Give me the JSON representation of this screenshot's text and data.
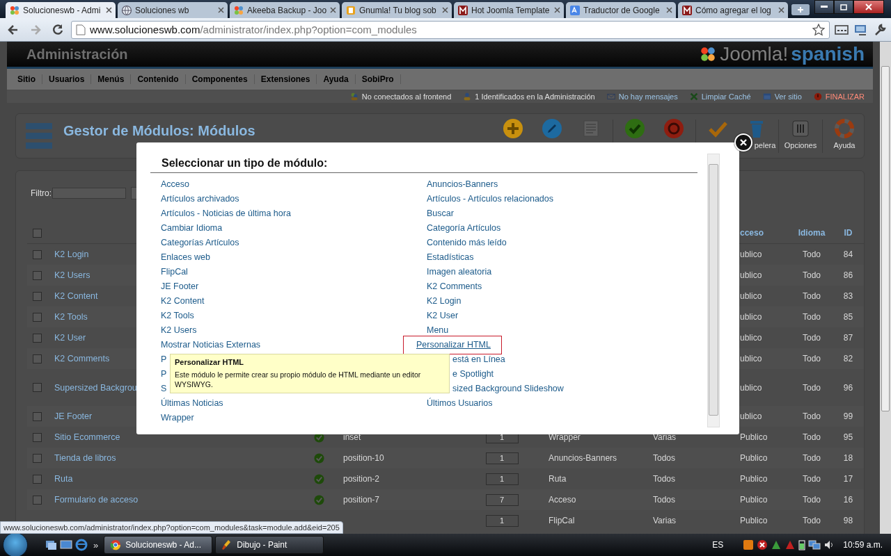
{
  "browser": {
    "tabs": [
      {
        "title": "Solucioneswb - Admi",
        "selected": true
      },
      {
        "title": "Soluciones wb",
        "selected": false
      },
      {
        "title": "Akeeba Backup - Joo",
        "selected": false
      },
      {
        "title": "Gnumla! Tu blog sob",
        "selected": false
      },
      {
        "title": "Hot Joomla Template",
        "selected": false
      },
      {
        "title": "Traductor de Google",
        "selected": false
      },
      {
        "title": "Cómo agregar el log",
        "selected": false
      }
    ],
    "address": {
      "host": "www.solucioneswb.com",
      "path": "/administrator/index.php?option=com_modules"
    }
  },
  "header": {
    "title": "Administración",
    "logo": "Joomla!",
    "logo_suffix": "spanish"
  },
  "menu": [
    "Sitio",
    "Usuarios",
    "Menús",
    "Contenido",
    "Componentes",
    "Extensiones",
    "Ayuda",
    "SobiPro"
  ],
  "status_links": [
    {
      "label": "No conectados al frontend",
      "kind": "users"
    },
    {
      "label": "1 Identificados en la Administración",
      "kind": "admins"
    },
    {
      "label": "No hay mensajes",
      "kind": "messages"
    },
    {
      "label": "Limpiar Caché",
      "kind": "cache"
    },
    {
      "label": "Ver sitio",
      "kind": "site"
    },
    {
      "label": "FINALIZAR",
      "kind": "logout"
    }
  ],
  "toolbar": {
    "title": "Gestor de Módulos: Módulos",
    "buttons": [
      {
        "kind": "new"
      },
      {
        "kind": "edit"
      },
      {
        "kind": "copy"
      },
      {
        "kind": "divider"
      },
      {
        "kind": "publish"
      },
      {
        "kind": "unpublish"
      },
      {
        "kind": "divider"
      },
      {
        "kind": "checkin"
      },
      {
        "kind": "trash",
        "label": "pelera"
      },
      {
        "kind": "divider"
      },
      {
        "kind": "options",
        "label": "Opciones"
      },
      {
        "kind": "divider"
      },
      {
        "kind": "help",
        "label": "Ayuda"
      }
    ]
  },
  "filter": {
    "label": "Filtro:"
  },
  "table": {
    "header": {
      "checked": false,
      "access": "cceso",
      "language": "Idioma",
      "id": "ID"
    },
    "rows": [
      {
        "kind": "single",
        "checked": false,
        "name": "K2 Login",
        "access": "ublico",
        "language": "Todo",
        "id": "84"
      },
      {
        "kind": "single",
        "checked": false,
        "name": "K2 Users",
        "access": "ublico",
        "language": "Todo",
        "id": "86"
      },
      {
        "kind": "single",
        "checked": false,
        "name": "K2 Content",
        "access": "ublico",
        "language": "Todo",
        "id": "83"
      },
      {
        "kind": "single",
        "checked": false,
        "name": "K2 Tools",
        "access": "ublico",
        "language": "Todo",
        "id": "85"
      },
      {
        "kind": "single",
        "checked": false,
        "name": "K2 User",
        "access": "ublico",
        "language": "Todo",
        "id": "87"
      },
      {
        "kind": "single",
        "checked": false,
        "name": "K2 Comments",
        "access": "ublico",
        "language": "Todo",
        "id": "82"
      },
      {
        "kind": "double",
        "checked": false,
        "name": "Supersized Backgrou",
        "access": "ublico",
        "language": "Todo",
        "id": "96"
      },
      {
        "kind": "single",
        "checked": false,
        "name": "JE Footer",
        "access": "ublico",
        "language": "Todo",
        "id": "99"
      },
      {
        "kind": "single",
        "checked": false,
        "name": "Sitio Ecommerce",
        "published": true,
        "position": "inset",
        "order": "1",
        "type": "Wrapper",
        "pages": "Varias",
        "access": "Publico",
        "language": "Todo",
        "id": "95"
      },
      {
        "kind": "single",
        "checked": false,
        "name": "Tienda de libros",
        "published": true,
        "position": "position-10",
        "order": "1",
        "type": "Anuncios-Banners",
        "pages": "Todos",
        "access": "Publico",
        "language": "Todo",
        "id": "18"
      },
      {
        "kind": "single",
        "checked": false,
        "name": "Ruta",
        "published": true,
        "position": "position-2",
        "order": "1",
        "type": "Ruta",
        "pages": "Todos",
        "access": "Publico",
        "language": "Todo",
        "id": "17"
      },
      {
        "kind": "single",
        "checked": false,
        "name": "Formulario de acceso",
        "published": true,
        "position": "position-7",
        "order": "7",
        "type": "Acceso",
        "pages": "Todos",
        "access": "Publico",
        "language": "Todo",
        "id": "16"
      },
      {
        "kind": "single",
        "order": "1",
        "type": "FlipCal",
        "pages": "Varias",
        "access": "Publico",
        "language": "Todo",
        "id": "98"
      }
    ]
  },
  "modal": {
    "title": "Seleccionar un tipo de módulo:",
    "columns": [
      [
        {
          "label": "Acceso",
          "kind": "link",
          "selected": false
        },
        {
          "label": "Artículos archivados",
          "kind": "link",
          "selected": false
        },
        {
          "label": "Artículos - Noticias de última hora",
          "kind": "link",
          "selected": false
        },
        {
          "label": "Cambiar Idioma",
          "kind": "link",
          "selected": false
        },
        {
          "label": "Categorías Artículos",
          "kind": "link",
          "selected": false
        },
        {
          "label": "Enlaces web",
          "kind": "link",
          "selected": false
        },
        {
          "label": "FlipCal",
          "kind": "link",
          "selected": false
        },
        {
          "label": "JE Footer",
          "kind": "link",
          "selected": false
        },
        {
          "label": "K2 Content",
          "kind": "link",
          "selected": false
        },
        {
          "label": "K2 Tools",
          "kind": "link",
          "selected": false
        },
        {
          "label": "K2 Users",
          "kind": "link",
          "selected": false
        },
        {
          "label": "Mostrar Noticias Externas",
          "kind": "link",
          "selected": false
        },
        {
          "label": "P",
          "kind": "cut",
          "selected": false
        },
        {
          "label": "P",
          "kind": "cut",
          "selected": false
        },
        {
          "label": "S",
          "kind": "cut",
          "selected": false
        },
        {
          "label": "Últimas Noticias",
          "kind": "link",
          "selected": false
        },
        {
          "label": "Wrapper",
          "kind": "link",
          "selected": false
        }
      ],
      [
        {
          "label": "Anuncios-Banners",
          "kind": "link",
          "selected": false
        },
        {
          "label": "Artículos - Artículos relacionados",
          "kind": "link",
          "selected": false
        },
        {
          "label": "Buscar",
          "kind": "link",
          "selected": false
        },
        {
          "label": "Categoría Artículos",
          "kind": "link",
          "selected": false
        },
        {
          "label": "Contenido más leído",
          "kind": "link",
          "selected": false
        },
        {
          "label": "Estadísticas",
          "kind": "link",
          "selected": false
        },
        {
          "label": "Imagen aleatoria",
          "kind": "link",
          "selected": false
        },
        {
          "label": "K2 Comments",
          "kind": "link",
          "selected": false
        },
        {
          "label": "K2 Login",
          "kind": "link",
          "selected": false
        },
        {
          "label": "K2 User",
          "kind": "link",
          "selected": false
        },
        {
          "label": "Menu",
          "kind": "link",
          "selected": false
        },
        {
          "label": "Personalizar HTML",
          "kind": "link",
          "selected": true
        },
        {
          "label": "está en Línea",
          "kind": "cut",
          "selected": false
        },
        {
          "label": "e Spotlight",
          "kind": "cut",
          "selected": false
        },
        {
          "label": "sized Background Slideshow",
          "kind": "cut",
          "selected": false
        },
        {
          "label": "Últimos Usuarios",
          "kind": "link",
          "selected": false
        }
      ]
    ],
    "tooltip": {
      "title": "Personalizar HTML",
      "text": "Este módulo le permite crear su propio módulo de HTML mediante un editor WYSIWYG."
    }
  },
  "status_url": "www.solucioneswb.com/administrator/index.php?option=com_modules&task=module.add&eid=205",
  "taskbar": {
    "more": "»",
    "tasks": [
      {
        "label": "Solucioneswb - Ad...",
        "selected": true
      },
      {
        "label": "Dibujo - Paint",
        "selected": false
      }
    ],
    "language": "ES",
    "clock": "10:59 a.m."
  }
}
